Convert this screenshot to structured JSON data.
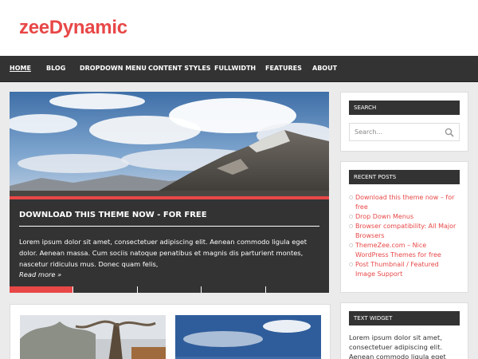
{
  "site": {
    "title": "zeeDynamic"
  },
  "nav": {
    "items": [
      {
        "label": "Home",
        "active": true
      },
      {
        "label": "Blog"
      },
      {
        "label": "Dropdown Menu"
      },
      {
        "label": "Content Styles"
      },
      {
        "label": "Fullwidth"
      },
      {
        "label": "Features"
      },
      {
        "label": "About"
      }
    ]
  },
  "slider": {
    "title": "Download this Theme now - for free",
    "excerpt": "Lorem ipsum dolor sit amet, consectetuer adipiscing elit. Aenean commodo ligula eget dolor. Aenean massa. Cum sociis natoque penatibus et magnis dis parturient montes, nascetur ridiculus mus. Donec quam felis,",
    "read_more": "Read more »",
    "slides": 5,
    "active_slide": 1
  },
  "sidebar": {
    "search": {
      "title": "Search",
      "placeholder": "Search..."
    },
    "recent_posts": {
      "title": "Recent Posts",
      "items": [
        "Download this theme now – for free",
        "Drop Down Menus",
        "Browser compatibility: All Major Browsers",
        "ThemeZee.com – Nice WordPress Themes for free",
        "Post Thumbnail / Featured Image Support"
      ]
    },
    "text_widget": {
      "title": "Text Widget",
      "body": "Lorem ipsum dolor sit amet, consectetuer adipiscing elit. Aenean commodo ligula eget dolor."
    }
  },
  "colors": {
    "accent": "#e84747",
    "dark": "#333333",
    "background": "#ebebeb"
  }
}
